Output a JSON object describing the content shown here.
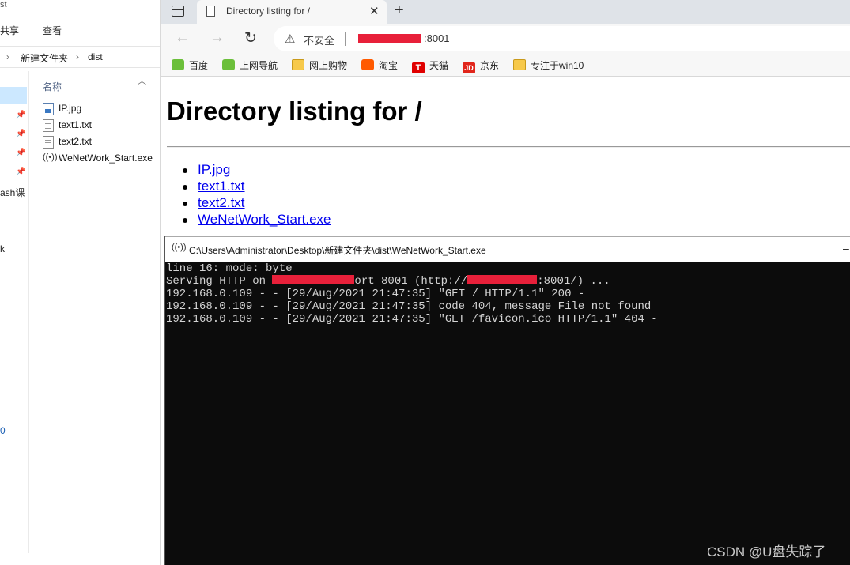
{
  "explorer": {
    "title_fragment": "st",
    "menu": [
      "共享",
      "查看"
    ],
    "breadcrumb": [
      "新建文件夹",
      "dist"
    ],
    "column_header": "名称",
    "nav_fragments": [
      "ash课",
      "k",
      "0"
    ],
    "files": [
      {
        "name": "IP.jpg",
        "icon": "image-file-icon"
      },
      {
        "name": "text1.txt",
        "icon": "text-file-icon"
      },
      {
        "name": "text2.txt",
        "icon": "text-file-icon"
      },
      {
        "name": "WeNetWork_Start.exe",
        "icon": "broadcast-app-icon"
      }
    ]
  },
  "browser": {
    "tab_title": "Directory listing for /",
    "insecure_label": "不安全",
    "url_port": ":8001",
    "bookmarks": [
      "百度",
      "上网导航",
      "网上购物",
      "淘宝",
      "天猫",
      "京东",
      "专注于win10"
    ],
    "page": {
      "heading": "Directory listing for /",
      "links": [
        "IP.jpg",
        "text1.txt",
        "text2.txt",
        "WeNetWork_Start.exe"
      ]
    }
  },
  "console": {
    "title": "C:\\Users\\Administrator\\Desktop\\新建文件夹\\dist\\WeNetWork_Start.exe",
    "line1": "line 16: mode: byte",
    "line2_a": "Serving HTTP on ",
    "line2_b": "ort 8001 (http://",
    "line2_c": ":8001/) ...",
    "line3": "192.168.0.109 - - [29/Aug/2021 21:47:35] \"GET / HTTP/1.1\" 200 -",
    "line4": "192.168.0.109 - - [29/Aug/2021 21:47:35] code 404, message File not found",
    "line5": "192.168.0.109 - - [29/Aug/2021 21:47:35] \"GET /favicon.ico HTTP/1.1\" 404 -"
  },
  "watermark": "CSDN @U盘失踪了",
  "colors": {
    "link": "#0000ee",
    "redaction": "#e8203a",
    "console_bg": "#0c0c0c"
  }
}
